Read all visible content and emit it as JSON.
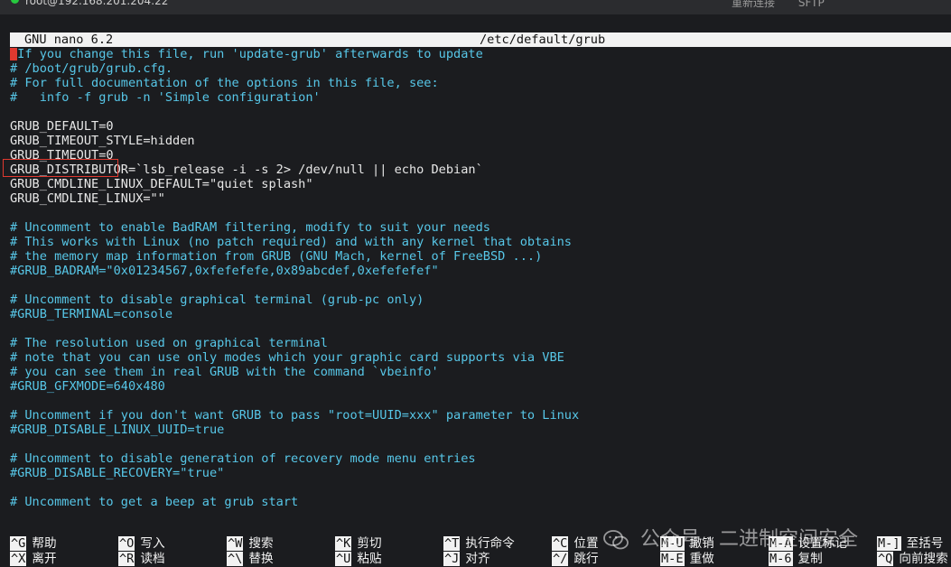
{
  "window": {
    "title": "root@192.168.201.204:22",
    "toolbar_items": [
      "重新连接",
      "SFTP"
    ]
  },
  "nano": {
    "app_name": "GNU nano 6.2",
    "file_path": "/etc/default/grub"
  },
  "buffer": {
    "lines": [
      {
        "text": " If you change this file, run 'update-grub' afterwards to update",
        "type": "comment",
        "cursor": true
      },
      {
        "text": "# /boot/grub/grub.cfg.",
        "type": "comment"
      },
      {
        "text": "# For full documentation of the options in this file, see:",
        "type": "comment"
      },
      {
        "text": "#   info -f grub -n 'Simple configuration'",
        "type": "comment"
      },
      {
        "text": "",
        "type": "normal"
      },
      {
        "text": "GRUB_DEFAULT=0",
        "type": "normal"
      },
      {
        "text": "GRUB_TIMEOUT_STYLE=hidden",
        "type": "normal"
      },
      {
        "text": "GRUB_TIMEOUT=0",
        "type": "normal",
        "highlighted": true
      },
      {
        "text": "GRUB_DISTRIBUTOR=`lsb_release -i -s 2> /dev/null || echo Debian`",
        "type": "normal"
      },
      {
        "text": "GRUB_CMDLINE_LINUX_DEFAULT=\"quiet splash\"",
        "type": "normal"
      },
      {
        "text": "GRUB_CMDLINE_LINUX=\"\"",
        "type": "normal"
      },
      {
        "text": "",
        "type": "normal"
      },
      {
        "text": "# Uncomment to enable BadRAM filtering, modify to suit your needs",
        "type": "comment"
      },
      {
        "text": "# This works with Linux (no patch required) and with any kernel that obtains",
        "type": "comment"
      },
      {
        "text": "# the memory map information from GRUB (GNU Mach, kernel of FreeBSD ...)",
        "type": "comment"
      },
      {
        "text": "#GRUB_BADRAM=\"0x01234567,0xfefefefe,0x89abcdef,0xefefefef\"",
        "type": "comment"
      },
      {
        "text": "",
        "type": "normal"
      },
      {
        "text": "# Uncomment to disable graphical terminal (grub-pc only)",
        "type": "comment"
      },
      {
        "text": "#GRUB_TERMINAL=console",
        "type": "comment"
      },
      {
        "text": "",
        "type": "normal"
      },
      {
        "text": "# The resolution used on graphical terminal",
        "type": "comment"
      },
      {
        "text": "# note that you can use only modes which your graphic card supports via VBE",
        "type": "comment"
      },
      {
        "text": "# you can see them in real GRUB with the command `vbeinfo'",
        "type": "comment"
      },
      {
        "text": "#GRUB_GFXMODE=640x480",
        "type": "comment"
      },
      {
        "text": "",
        "type": "normal"
      },
      {
        "text": "# Uncomment if you don't want GRUB to pass \"root=UUID=xxx\" parameter to Linux",
        "type": "comment"
      },
      {
        "text": "#GRUB_DISABLE_LINUX_UUID=true",
        "type": "comment"
      },
      {
        "text": "",
        "type": "normal"
      },
      {
        "text": "# Uncomment to disable generation of recovery mode menu entries",
        "type": "comment"
      },
      {
        "text": "#GRUB_DISABLE_RECOVERY=\"true\"",
        "type": "comment"
      },
      {
        "text": "",
        "type": "normal"
      },
      {
        "text": "# Uncomment to get a beep at grub start",
        "type": "comment"
      }
    ]
  },
  "shortcuts": [
    {
      "key": "^G",
      "label": "帮助"
    },
    {
      "key": "^X",
      "label": "离开"
    },
    {
      "key": "^O",
      "label": "写入"
    },
    {
      "key": "^R",
      "label": "读档"
    },
    {
      "key": "^W",
      "label": "搜索"
    },
    {
      "key": "^\\",
      "label": "替换"
    },
    {
      "key": "^K",
      "label": "剪切"
    },
    {
      "key": "^U",
      "label": "粘贴"
    },
    {
      "key": "^T",
      "label": "执行命令"
    },
    {
      "key": "^J",
      "label": "对齐"
    },
    {
      "key": "^C",
      "label": "位置"
    },
    {
      "key": "^/",
      "label": "跳行"
    },
    {
      "key": "M-U",
      "label": "撤销"
    },
    {
      "key": "M-E",
      "label": "重做"
    },
    {
      "key": "M-A",
      "label": "设置标记"
    },
    {
      "key": "M-6",
      "label": "复制"
    },
    {
      "key": "M-]",
      "label": "至括号"
    },
    {
      "key": "^Q",
      "label": "向前搜索"
    }
  ],
  "watermark": {
    "text": "公众号 · 二进制空间安全",
    "icon": "wechat-icon"
  },
  "colors": {
    "comment": "#57c7e8",
    "highlight_box": "#e0392f",
    "cursor": "#e0392f"
  }
}
